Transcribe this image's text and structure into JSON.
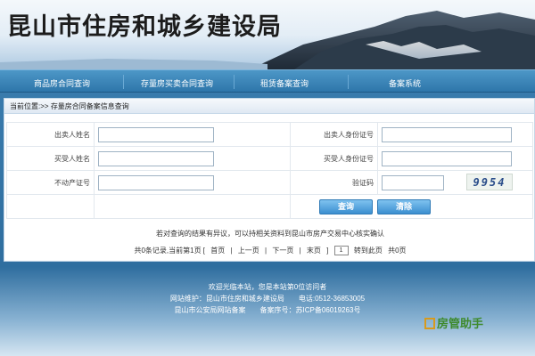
{
  "header": {
    "title": "昆山市住房和城乡建设局"
  },
  "nav": {
    "items": [
      {
        "label": "商品房合同查询"
      },
      {
        "label": "存量房买卖合同查询"
      },
      {
        "label": "租赁备案查询"
      },
      {
        "label": "备案系统"
      }
    ]
  },
  "breadcrumb": {
    "prefix": "当前位置:>>",
    "current": "存量房合同备案信息查询"
  },
  "form": {
    "seller_name_label": "出卖人姓名",
    "seller_id_label": "出卖人身份证号",
    "buyer_name_label": "买受人姓名",
    "buyer_id_label": "买受人身份证号",
    "property_cert_label": "不动产证号",
    "captcha_label": "验证码",
    "seller_name_value": "",
    "seller_id_value": "",
    "buyer_name_value": "",
    "buyer_id_value": "",
    "property_cert_value": "",
    "captcha_value": "",
    "captcha_image_text": "9954",
    "query_button": "查询",
    "clear_button": "清除"
  },
  "notice": "若对查询的结果有异议，可以持相关资料到昆山市房产交易中心核实确认",
  "pager": {
    "summary": "共0条记录,当前第1页 [",
    "first": "首页",
    "prev": "上一页",
    "next": "下一页",
    "last": "末页",
    "close_bracket": "]",
    "page_input": "1",
    "goto": "转到此页",
    "total_pages": "共0页",
    "sep": "|"
  },
  "footer": {
    "line1": "欢迎光临本站，您是本站第0位访问者",
    "line2": "网站维护：昆山市住房和城乡建设局　　电话:0512-36853005",
    "line3": "昆山市公安局网站备案　　备案序号：苏ICP备06019263号"
  },
  "brand": {
    "label": "房管助手"
  },
  "colors": {
    "nav": "#2e76aa",
    "button": "#3b8fd0",
    "brand": "#3e8a2c"
  }
}
